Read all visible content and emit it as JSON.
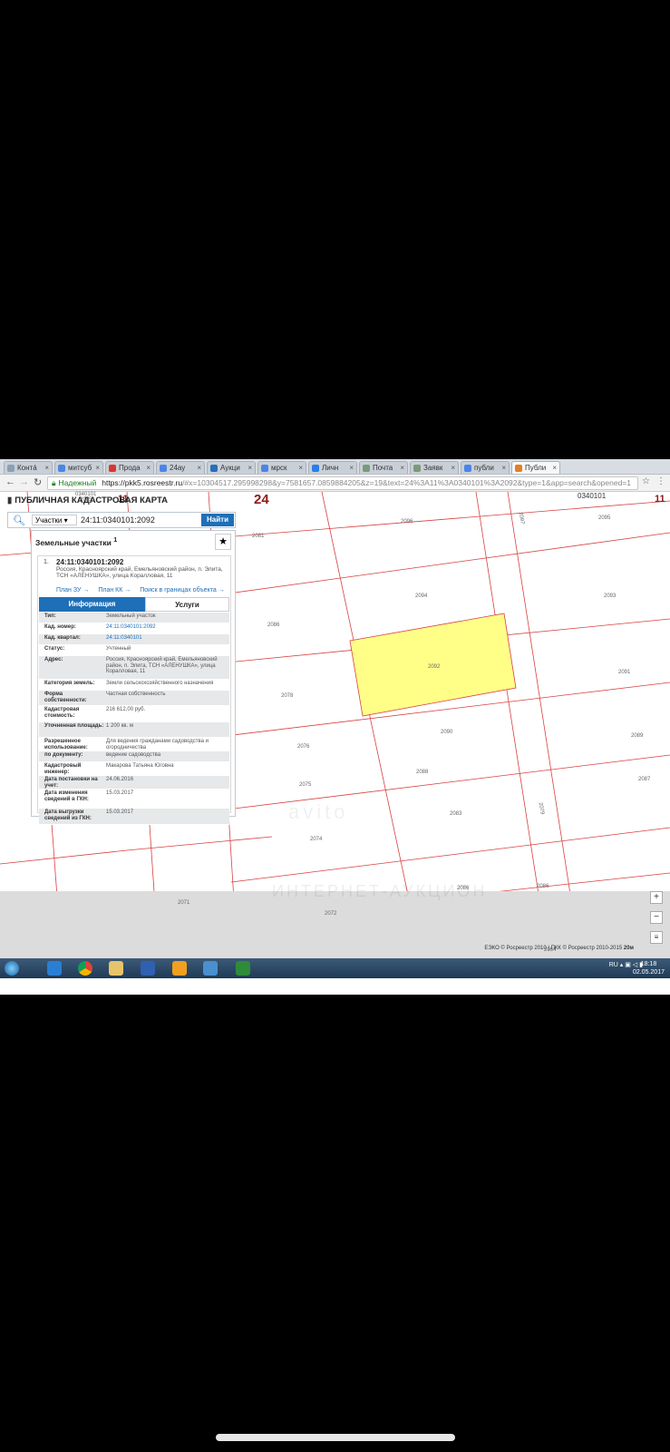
{
  "browser": {
    "tabs": [
      {
        "label": "Контá",
        "color": "#8aa0b8"
      },
      {
        "label": "митсуб",
        "color": "#4a86e8"
      },
      {
        "label": "Прода",
        "color": "#d33"
      },
      {
        "label": "24ау",
        "color": "#4a86e8"
      },
      {
        "label": "Аукци",
        "color": "#2a6ebb"
      },
      {
        "label": "мрск",
        "color": "#4a86e8"
      },
      {
        "label": "Личн",
        "color": "#2b7de9"
      },
      {
        "label": "Почта",
        "color": "#7a9a7a"
      },
      {
        "label": "Заявк",
        "color": "#7a9a7a"
      },
      {
        "label": "публи",
        "color": "#4a86e8"
      },
      {
        "label": "Публи",
        "color": "#e67e22"
      }
    ],
    "secure_label": "Надежный",
    "url_host": "https://pkk5.rosreestr.ru",
    "url_rest": "/#x=10304517.295998298&y=7581657.0859884205&z=19&text=24%3A11%3A0340101%3A2092&type=1&app=search&opened=1"
  },
  "app": {
    "title": "ПУБЛИЧНАЯ КАДАСТРОВАЯ КАРТА",
    "search": {
      "category": "Участки",
      "query": "24:11:0340101:2092",
      "button": "Найти"
    },
    "panel_title": "Земельные участки",
    "panel_count": "1"
  },
  "parcel": {
    "index": "1.",
    "cad_number": "24:11:0340101:2092",
    "address": "Россия, Красноярский край, Емельяновский район, п. Элита, ТСН «АЛЕНУШКА», улица Коралловая, 11",
    "links": [
      "План ЗУ →",
      "План КК →",
      "Поиск в границах объекта →"
    ],
    "tab_info": "Информация",
    "tab_services": "Услуги",
    "rows": [
      {
        "k": "Тип:",
        "v": "Земельный участок",
        "h": 11
      },
      {
        "k": "Кад. номер:",
        "v": "24:11:0340101:2092",
        "h": 11,
        "link": true
      },
      {
        "k": "Кад. квартал:",
        "v": "24:11:0340101",
        "h": 11,
        "link": true
      },
      {
        "k": "Статус:",
        "v": "Учтенный",
        "h": 11
      },
      {
        "k": "Адрес:",
        "v": "Россия, Красноярский край, Емельяновский район, п. Элита, ТСН «АЛЕНУШКА», улица Коралловая, 11",
        "h": 25
      },
      {
        "k": "Категория земель:",
        "v": "Земли сельскохозяйственного назначения",
        "h": 11
      },
      {
        "k": "Форма собственности:",
        "v": "Частная собственность",
        "h": 16
      },
      {
        "k": "Кадастровая стоимость:",
        "v": "216 612,00 руб.",
        "h": 17
      },
      {
        "k": "Уточненная площадь:",
        "v": "1 200 кв. м",
        "h": 16
      },
      {
        "k": "Разрешенное использование:",
        "v": "Для ведения гражданами садоводства и огородничества",
        "h": 14
      },
      {
        "k": "по документу:",
        "v": "ведение садоводства",
        "h": 11
      },
      {
        "k": "Кадастровый инженер:",
        "v": "Макарова Татьяна Юговна",
        "h": 14
      },
      {
        "k": "Дата постановки на учет:",
        "v": "24.06.2016",
        "h": 14
      },
      {
        "k": "Дата изменения сведений в ГКН:",
        "v": "15.03.2017",
        "h": 20
      },
      {
        "k": "Дата выгрузки сведений из ГКН:",
        "v": "15.03.2017",
        "h": 17
      }
    ]
  },
  "map": {
    "big_labels": [
      {
        "t": "24",
        "cls": "b24"
      },
      {
        "t": "11",
        "cls": "b11a"
      },
      {
        "t": "11",
        "cls": "b11b"
      }
    ],
    "quarter_labels": [
      "0340101",
      "0340101"
    ],
    "parcel_labels": [
      "2081",
      "2096",
      "2095",
      "2094",
      "2093",
      "2086",
      "2092",
      "2091",
      "2078",
      "2090",
      "2076",
      "2089",
      "2075",
      "2088",
      "2087",
      "2074",
      "2083",
      "2086",
      "2086",
      "2071",
      "2072",
      "2064",
      "2079",
      "2097",
      "2085"
    ],
    "highlight_color": "#ffff88",
    "credit": "ЕЭКО © Росреестр 2010 | ПКК © Росреестр 2010-2015",
    "scale": "20м",
    "watermark1": "avito",
    "watermark2": "ИНТЕРНЕТ-АУКЦИОН"
  },
  "taskbar": {
    "lang": "RU",
    "time": "18:18",
    "date": "02.05.2017"
  }
}
